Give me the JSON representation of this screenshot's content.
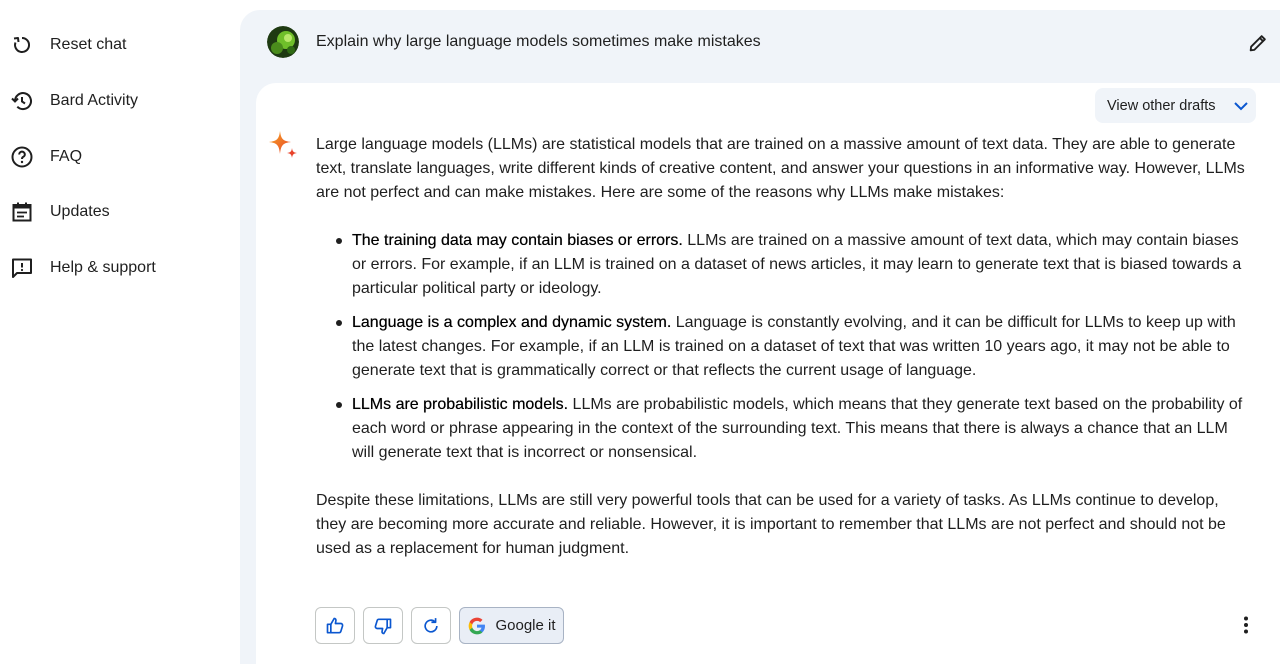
{
  "sidebar": {
    "items": [
      {
        "label": "Reset chat",
        "icon": "reset-icon"
      },
      {
        "label": "Bard Activity",
        "icon": "history-icon"
      },
      {
        "label": "FAQ",
        "icon": "help-circle-icon"
      },
      {
        "label": "Updates",
        "icon": "calendar-icon"
      },
      {
        "label": "Help & support",
        "icon": "feedback-icon"
      }
    ]
  },
  "prompt": {
    "text": "Explain why large language models sometimes make mistakes"
  },
  "response": {
    "drafts_label": "View other drafts",
    "intro": "Large language models (LLMs) are statistical models that are trained on a massive amount of text data. They are able to generate text, translate languages, write different kinds of creative content, and answer your questions in an informative way. However, LLMs are not perfect and can make mistakes. Here are some of the reasons why LLMs make mistakes:",
    "bullets": [
      {
        "bold": "The training data may contain biases or errors.",
        "text": " LLMs are trained on a massive amount of text data, which may contain biases or errors. For example, if an LLM is trained on a dataset of news articles, it may learn to generate text that is biased towards a particular political party or ideology."
      },
      {
        "bold": "Language is a complex and dynamic system.",
        "text": " Language is constantly evolving, and it can be difficult for LLMs to keep up with the latest changes. For example, if an LLM is trained on a dataset of text that was written 10 years ago, it may not be able to generate text that is grammatically correct or that reflects the current usage of language."
      },
      {
        "bold": "LLMs are probabilistic models.",
        "text": " LLMs are probabilistic models, which means that they generate text based on the probability of each word or phrase appearing in the context of the surrounding text. This means that there is always a chance that an LLM will generate text that is incorrect or nonsensical."
      }
    ],
    "conclusion": "Despite these limitations, LLMs are still very powerful tools that can be used for a variety of tasks. As LLMs continue to develop, they are becoming more accurate and reliable. However, it is important to remember that LLMs are not perfect and should not be used as a replacement for human judgment."
  },
  "actions": {
    "google_label": "Google it"
  },
  "colors": {
    "panel_bg": "#f0f4f9",
    "accent_blue": "#0b57d0",
    "text": "#1f1f1f"
  }
}
